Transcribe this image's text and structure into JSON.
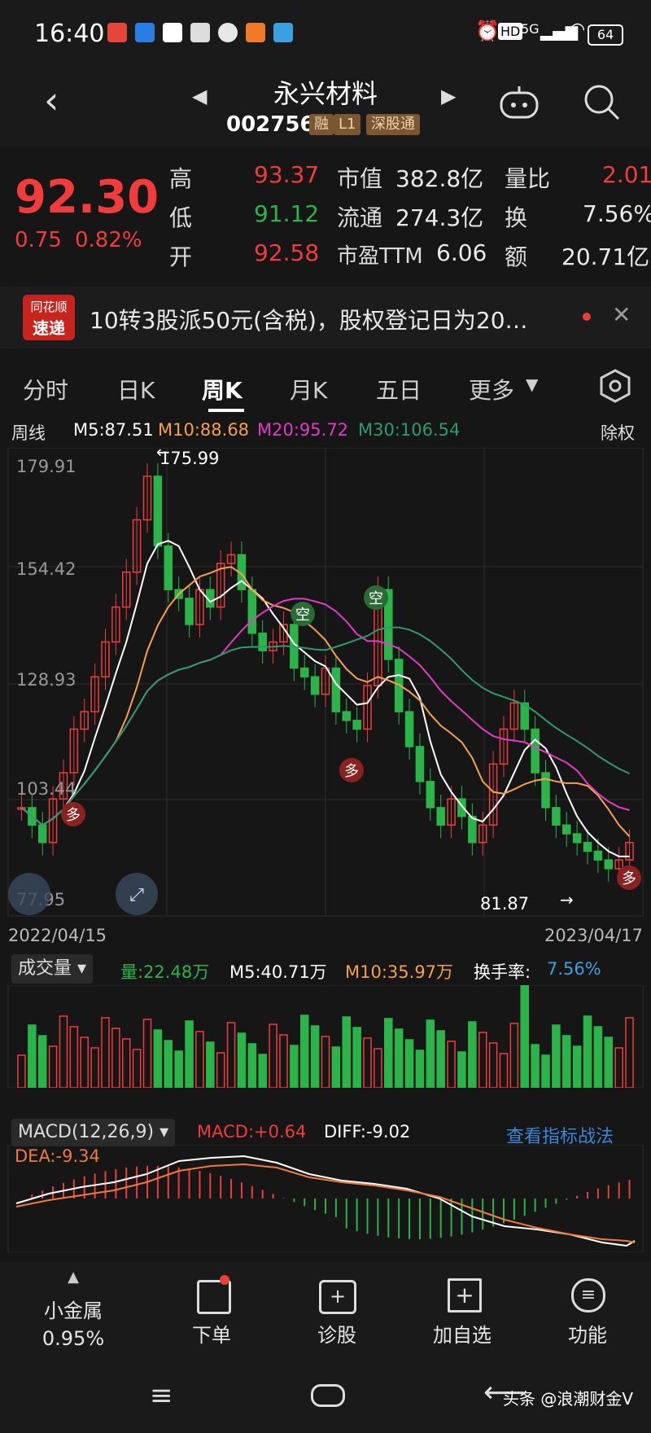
{
  "status_bar": {
    "time": "16:40",
    "battery": "64",
    "network": "5G"
  },
  "header": {
    "title": "永兴材料",
    "code": "002756",
    "tags": [
      "融",
      "L1",
      "深股通"
    ]
  },
  "quote": {
    "price": "92.30",
    "change": "0.75",
    "change_pct": "0.82%",
    "high_label": "高",
    "high": "93.37",
    "low_label": "低",
    "low": "91.12",
    "open_label": "开",
    "open": "92.58",
    "mktcap_label": "市值",
    "mktcap": "382.8亿",
    "float_label": "流通",
    "float": "274.3亿",
    "pe_label": "市盈TTM",
    "pe": "6.06",
    "volratio_label": "量比",
    "volratio": "2.01",
    "turnover_label": "换",
    "turnover": "7.56%",
    "amount_label": "额",
    "amount": "20.71亿"
  },
  "news": {
    "badge_line1": "同花顺",
    "badge_line2": "速递",
    "text": "10转3股派50元(含税)，股权登记日为20…"
  },
  "tabs": [
    "分时",
    "日K",
    "周K",
    "月K",
    "五日",
    "更多"
  ],
  "ma": {
    "period": "周线",
    "m5": "M5:87.51",
    "m10": "M10:88.68",
    "m20": "M20:95.72",
    "m30": "M30:106.54",
    "adjust": "除权"
  },
  "price_axis": {
    "top": "179.91",
    "mid1": "154.42",
    "mid2": "128.93",
    "mid3": "103.44",
    "bottom": "77.95",
    "high_mark": "175.99",
    "low_mark": "81.87",
    "start_date": "2022/04/15",
    "end_date": "2023/04/17"
  },
  "signals": {
    "kong": "空",
    "duo": "多"
  },
  "volume": {
    "label": "成交量",
    "vol": "量:22.48万",
    "m5": "M5:40.71万",
    "m10": "M10:35.97万",
    "turnover_label": "换手率:",
    "turnover": "7.56%"
  },
  "macd": {
    "label": "MACD(12,26,9)",
    "macd": "MACD:+0.64",
    "diff": "DIFF:-9.02",
    "dea": "DEA:-9.34",
    "link": "查看指标战法"
  },
  "bottom_nav": {
    "items": [
      {
        "label": "小金属",
        "sub": "0.95%"
      },
      {
        "label": "下单"
      },
      {
        "label": "诊股"
      },
      {
        "label": "加自选"
      },
      {
        "label": "功能"
      }
    ],
    "watermark": "头条 @浪潮财金V"
  },
  "colors": {
    "up": "#f03c3c",
    "down": "#2bb44a",
    "m5": "#ffffff",
    "m10": "#f5a04a",
    "m20": "#e03cc8",
    "m30": "#2e9a6e"
  }
}
